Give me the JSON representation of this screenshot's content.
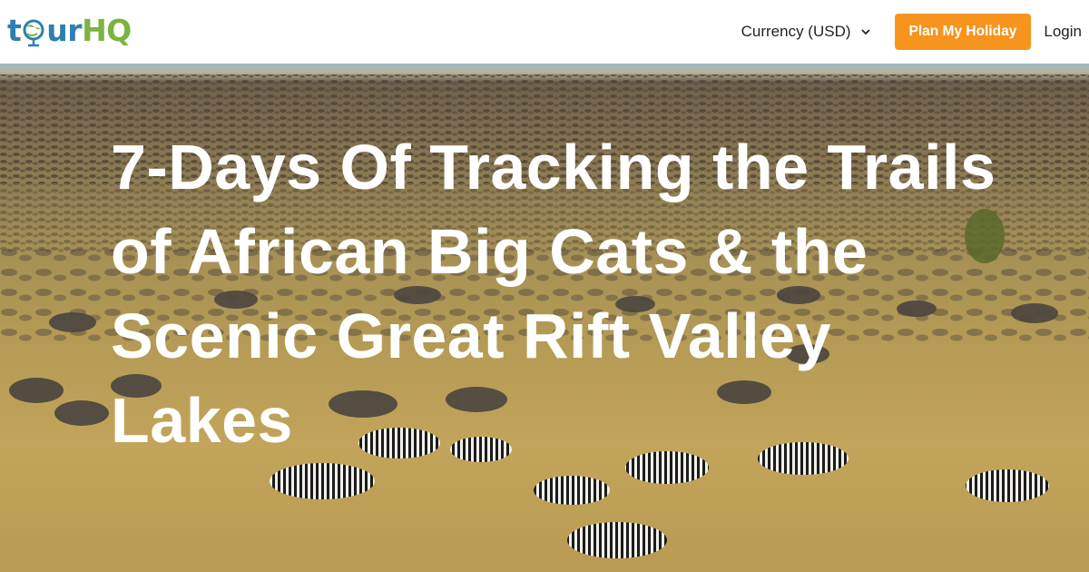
{
  "brand": {
    "logo_text_left": "t",
    "logo_text_mid": "ur",
    "logo_text_right": "HQ"
  },
  "nav": {
    "currency_label": "Currency (USD)",
    "plan_button": "Plan My Holiday",
    "login": "Login"
  },
  "hero": {
    "title": "7-Days Of Tracking the Trails of African Big Cats & the Scenic Great Rift Valley Lakes"
  },
  "colors": {
    "accent": "#f7941d",
    "logo_blue": "#2e7fb0",
    "logo_green": "#7cb342"
  },
  "icons": {
    "currency_chevron": "chevron-down-icon",
    "logo_globe": "globe-icon"
  }
}
